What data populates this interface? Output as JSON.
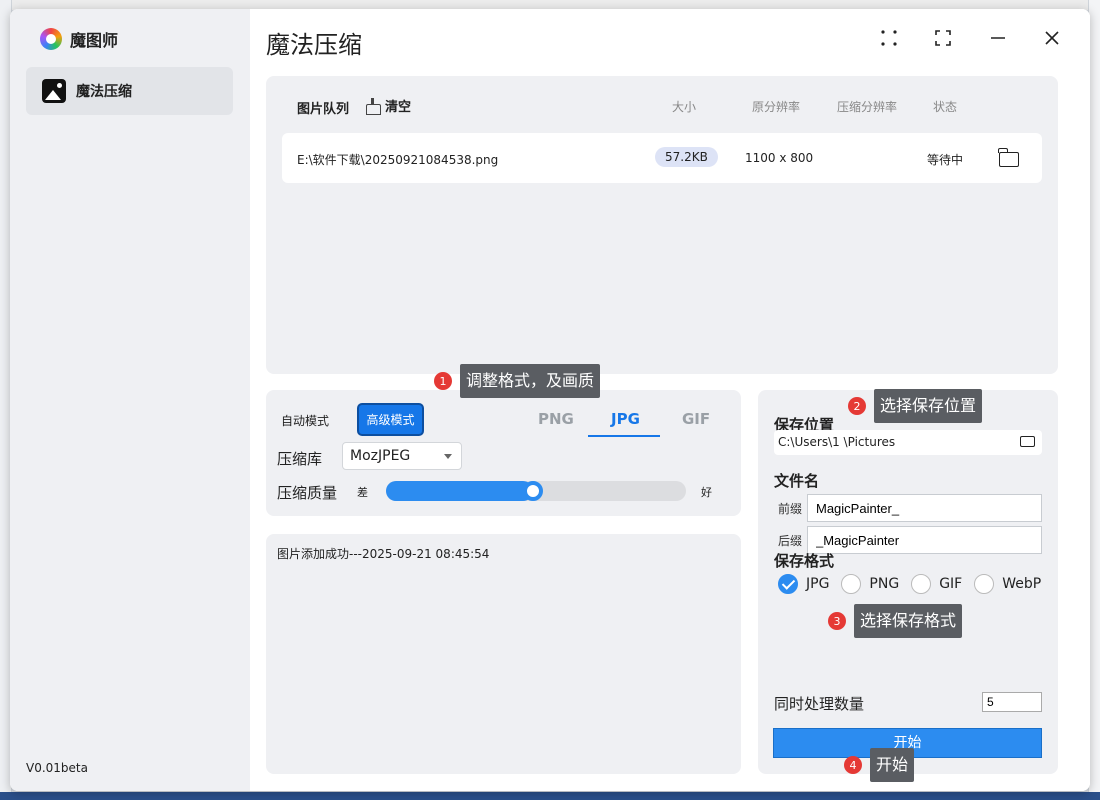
{
  "app": {
    "name": "魔图师",
    "version": "V0.01beta"
  },
  "sidebar": {
    "items": [
      {
        "label": "魔法压缩"
      }
    ]
  },
  "page": {
    "title": "魔法压缩"
  },
  "queue": {
    "title": "图片队列",
    "clear_label": "清空",
    "columns": {
      "size": "大小",
      "original_res": "原分辨率",
      "compressed_res": "压缩分辨率",
      "status": "状态"
    },
    "rows": [
      {
        "path": "E:\\软件下载\\20250921084538.png",
        "size": "57.2KB",
        "original_res": "1100 x 800",
        "compressed_res": "",
        "status": "等待中"
      }
    ]
  },
  "options": {
    "modes": {
      "auto": "自动模式",
      "advanced": "高级模式",
      "active": "advanced"
    },
    "formats": [
      "PNG",
      "JPG",
      "GIF"
    ],
    "active_format": "JPG",
    "library_label": "压缩库",
    "library_value": "MozJPEG",
    "quality_label": "压缩质量",
    "quality_low": "差",
    "quality_high": "好",
    "quality_level": 0.49
  },
  "log": {
    "lines": [
      "图片添加成功---2025-09-21 08:45:54"
    ]
  },
  "save": {
    "location_label": "保存位置",
    "location_value": "C:\\Users\\1       \\Pictures",
    "filename_label": "文件名",
    "prefix_label": "前缀",
    "prefix_value": "MagicPainter_",
    "suffix_label": "后缀",
    "suffix_value": "_MagicPainter",
    "format_label": "保存格式",
    "formats": [
      "JPG",
      "PNG",
      "GIF",
      "WebP"
    ],
    "selected_format": "JPG",
    "concurrency_label": "同时处理数量",
    "concurrency_value": "5",
    "start_label": "开始"
  },
  "callouts": [
    {
      "num": "1",
      "text": "调整格式，及画质"
    },
    {
      "num": "2",
      "text": "选择保存位置"
    },
    {
      "num": "3",
      "text": "选择保存格式"
    },
    {
      "num": "4",
      "text": "开始"
    }
  ],
  "colors": {
    "accent": "#2c8cf0",
    "panel": "#eff0f3",
    "sidebar": "#eff0f3",
    "callout_badge": "#e53935",
    "callout_box": "#5a5d62"
  }
}
